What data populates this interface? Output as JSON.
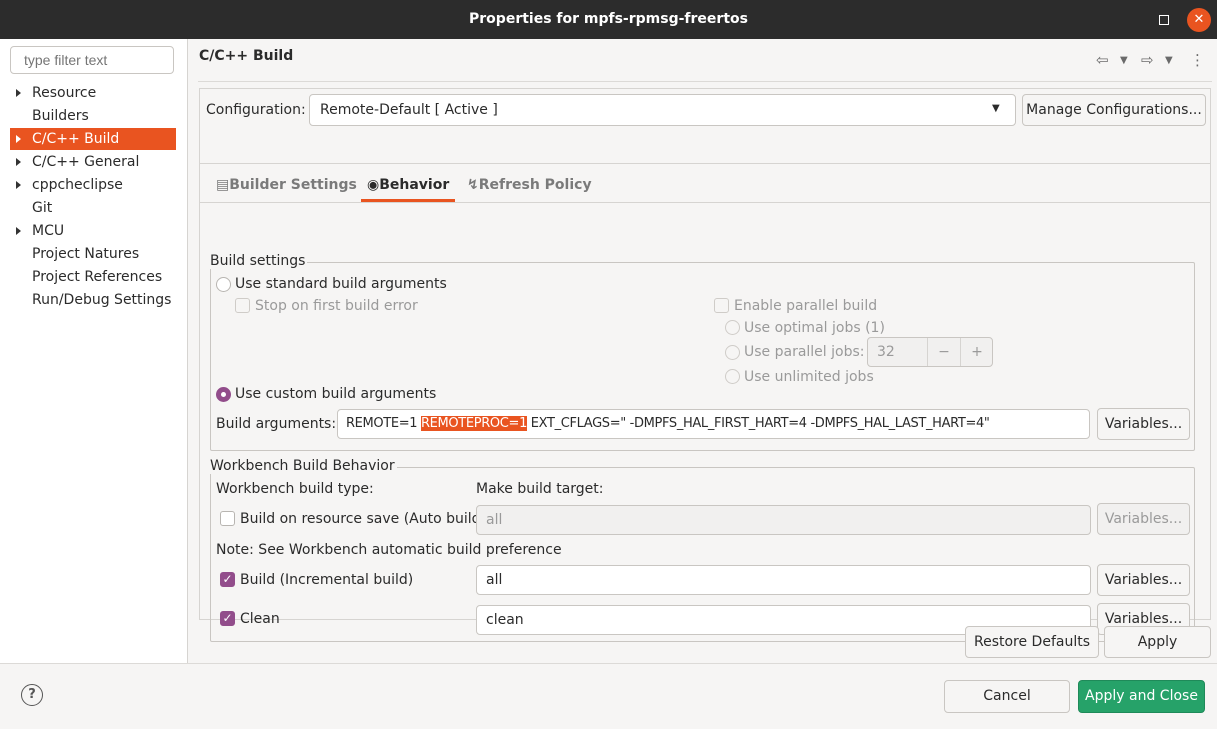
{
  "window": {
    "title": "Properties for mpfs-rpmsg-freertos"
  },
  "left": {
    "filter_placeholder": "type filter text",
    "items": [
      {
        "label": "Resource",
        "expandable": true,
        "selected": false
      },
      {
        "label": "Builders",
        "expandable": false,
        "selected": false
      },
      {
        "label": "C/C++ Build",
        "expandable": true,
        "selected": true
      },
      {
        "label": "C/C++ General",
        "expandable": true,
        "selected": false
      },
      {
        "label": "cppcheclipse",
        "expandable": true,
        "selected": false
      },
      {
        "label": "Git",
        "expandable": false,
        "selected": false
      },
      {
        "label": "MCU",
        "expandable": true,
        "selected": false
      },
      {
        "label": "Project Natures",
        "expandable": false,
        "selected": false
      },
      {
        "label": "Project References",
        "expandable": false,
        "selected": false
      },
      {
        "label": "Run/Debug Settings",
        "expandable": false,
        "selected": false
      }
    ]
  },
  "page": {
    "title": "C/C++ Build",
    "config_label": "Configuration:",
    "config_value": "Remote-Default  [ Active ]",
    "manage_label": "Manage Configurations..."
  },
  "tabs": [
    {
      "label": "Builder Settings",
      "icon": "builder-settings-icon",
      "active": false
    },
    {
      "label": "Behavior",
      "icon": "behavior-icon",
      "active": true
    },
    {
      "label": "Refresh Policy",
      "icon": "refresh-policy-icon",
      "active": false
    }
  ],
  "build_settings": {
    "title": "Build settings",
    "standard_args": "Use standard build arguments",
    "stop_first_error": "Stop on first build error",
    "enable_parallel": "Enable parallel build",
    "optimal_jobs": "Use optimal jobs (1)",
    "parallel_jobs": "Use parallel jobs:",
    "parallel_jobs_value": "32",
    "unlimited_jobs": "Use unlimited jobs",
    "custom_args": "Use custom build arguments",
    "build_args_label": "Build arguments:",
    "build_args_prefix": "REMOTE=1 ",
    "build_args_highlight": "REMOTEPROC=1",
    "build_args_suffix": " EXT_CFLAGS=\" -DMPFS_HAL_FIRST_HART=4 -DMPFS_HAL_LAST_HART=4\"",
    "variables_label": "Variables..."
  },
  "workbench": {
    "title": "Workbench Build Behavior",
    "build_type_label": "Workbench build type:",
    "make_target_label": "Make build target:",
    "auto_build_label": "Build on resource save (Auto build)",
    "auto_build_value": "all",
    "note": "Note: See Workbench automatic build preference",
    "incremental_label": "Build (Incremental build)",
    "incremental_value": "all",
    "clean_label": "Clean",
    "clean_value": "clean",
    "variables_label": "Variables..."
  },
  "footer": {
    "restore_defaults": "Restore Defaults",
    "apply": "Apply",
    "cancel": "Cancel",
    "apply_close": "Apply and Close"
  },
  "colors": {
    "accent": "#e95420",
    "check": "#924d8b",
    "primary_button": "#26a269",
    "titlebar": "#2c2c2c"
  }
}
